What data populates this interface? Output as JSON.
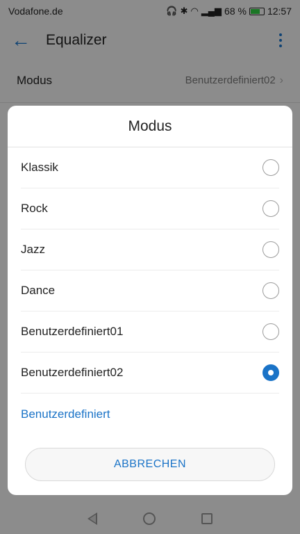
{
  "status_bar": {
    "carrier": "Vodafone.de",
    "battery_percent": "68 %",
    "time": "12:57"
  },
  "app_bar": {
    "title": "Equalizer"
  },
  "mode_row": {
    "label": "Modus",
    "value": "Benutzerdefiniert02"
  },
  "dialog": {
    "title": "Modus",
    "options": [
      {
        "label": "Klassik",
        "selected": false
      },
      {
        "label": "Rock",
        "selected": false
      },
      {
        "label": "Jazz",
        "selected": false
      },
      {
        "label": "Dance",
        "selected": false
      },
      {
        "label": "Benutzerdefiniert01",
        "selected": false
      },
      {
        "label": "Benutzerdefiniert02",
        "selected": true
      }
    ],
    "custom_link": "Benutzerdefiniert",
    "cancel_label": "ABBRECHEN"
  },
  "colors": {
    "accent": "#1a73c7"
  }
}
